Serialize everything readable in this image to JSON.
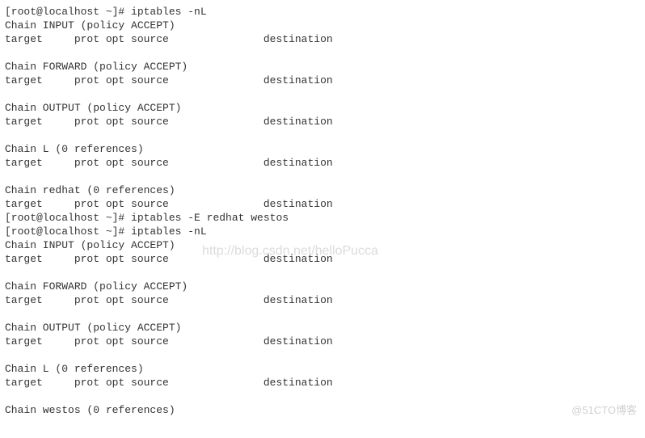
{
  "lines": {
    "l0": "[root@localhost ~]# iptables -nL",
    "l1": "Chain INPUT (policy ACCEPT)",
    "l2": "target     prot opt source               destination",
    "l3": "",
    "l4": "Chain FORWARD (policy ACCEPT)",
    "l5": "target     prot opt source               destination",
    "l6": "",
    "l7": "Chain OUTPUT (policy ACCEPT)",
    "l8": "target     prot opt source               destination",
    "l9": "",
    "l10": "Chain L (0 references)",
    "l11": "target     prot opt source               destination",
    "l12": "",
    "l13": "Chain redhat (0 references)",
    "l14": "target     prot opt source               destination",
    "l15": "[root@localhost ~]# iptables -E redhat westos",
    "l16": "[root@localhost ~]# iptables -nL",
    "l17": "Chain INPUT (policy ACCEPT)",
    "l18": "target     prot opt source               destination",
    "l19": "",
    "l20": "Chain FORWARD (policy ACCEPT)",
    "l21": "target     prot opt source               destination",
    "l22": "",
    "l23": "Chain OUTPUT (policy ACCEPT)",
    "l24": "target     prot opt source               destination",
    "l25": "",
    "l26": "Chain L (0 references)",
    "l27": "target     prot opt source               destination",
    "l28": "",
    "l29": "Chain westos (0 references)"
  },
  "watermark": "http://blog.csdn.net/helloPucca",
  "footer_watermark": "@51CTO博客"
}
